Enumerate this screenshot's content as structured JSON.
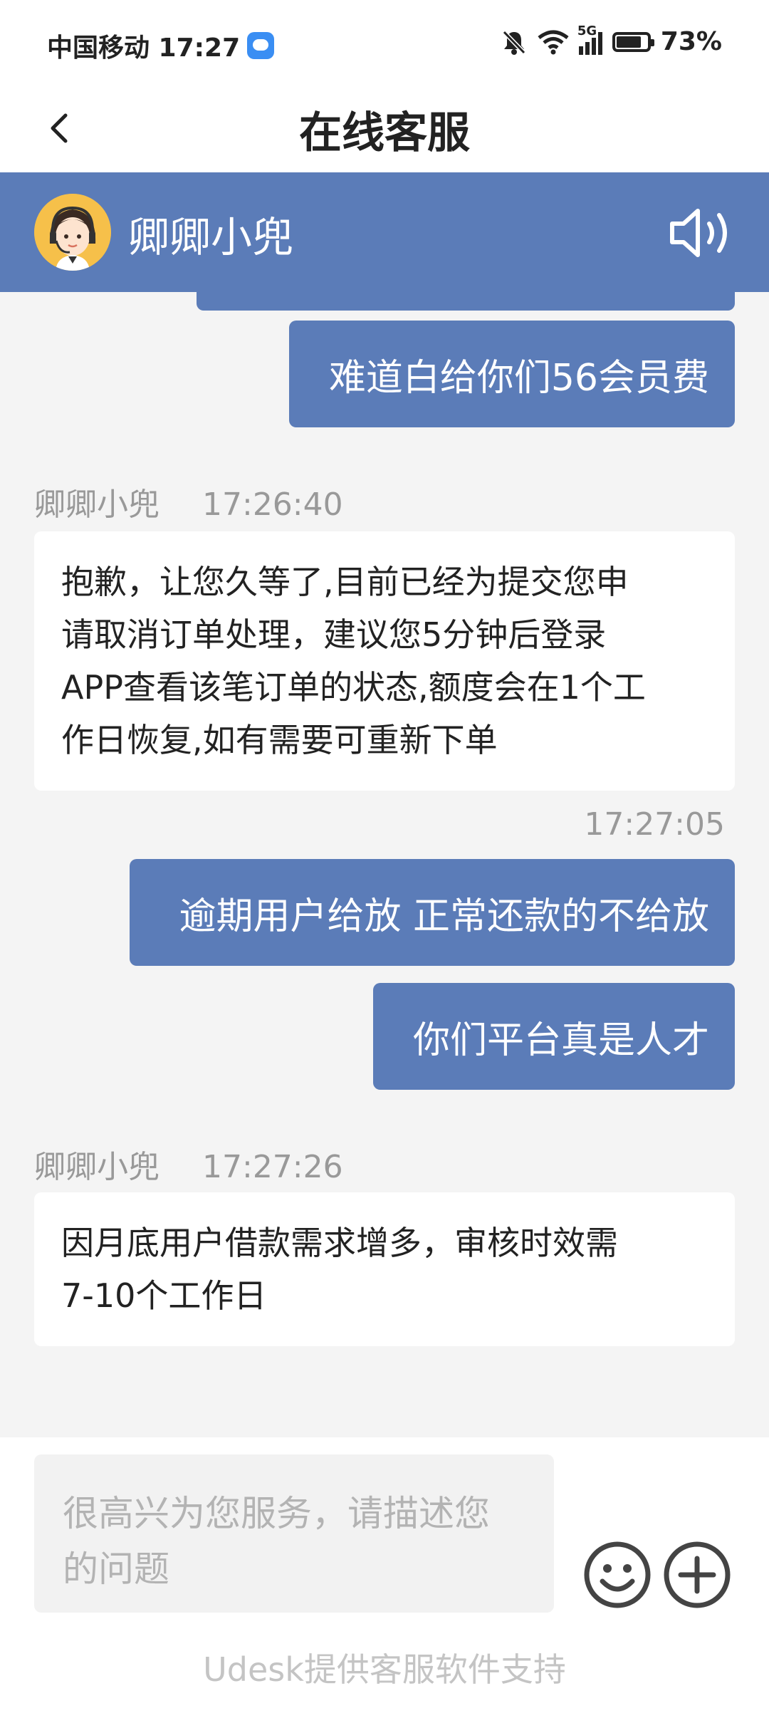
{
  "status_bar": {
    "carrier_time": "中国移动 17:27",
    "network_label": "5G",
    "battery": "73%"
  },
  "nav": {
    "title": "在线客服"
  },
  "agent": {
    "name": "卿卿小兜"
  },
  "chat": {
    "messages": [
      {
        "type": "outgoing",
        "text": "难道白给你们56会员费"
      },
      {
        "type": "incoming",
        "sender": "卿卿小兜",
        "time": "17:26:40",
        "lines": [
          "抱歉，让您久等了,目前已经为提交您申",
          "请取消订单处理，建议您5分钟后登录",
          "APP查看该笔订单的状态,额度会在1个工",
          "作日恢复,如有需要可重新下单"
        ]
      },
      {
        "type": "outgoing",
        "time": "17:27:05",
        "text": "逾期用户给放 正常还款的不给放"
      },
      {
        "type": "outgoing",
        "text": "你们平台真是人才"
      },
      {
        "type": "incoming",
        "sender": "卿卿小兜",
        "time": "17:27:26",
        "lines": [
          "因月底用户借款需求增多，审核时效需",
          "7-10个工作日"
        ]
      }
    ]
  },
  "input": {
    "placeholder_lines": [
      "很高兴为您服务，请描述您",
      "的问题"
    ]
  },
  "footer": {
    "text": "Udesk提供客服软件支持"
  },
  "colors": {
    "accent": "#5b7cb8",
    "chat_bg": "#f4f4f4",
    "meta_text": "#999999"
  },
  "icons": {
    "back": "chevron-left-icon",
    "speaker": "speaker-icon",
    "emoji": "smiley-icon",
    "plus": "plus-circle-icon"
  }
}
